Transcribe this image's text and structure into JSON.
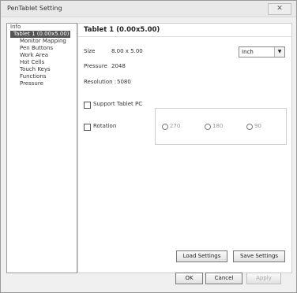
{
  "window": {
    "title": "PenTablet Setting",
    "close_label": "✕"
  },
  "sidebar": {
    "items": [
      {
        "label": "Info",
        "level": 0
      },
      {
        "label": "Tablet 1 (0.00x5.00)",
        "level": 0,
        "selected": true
      },
      {
        "label": "Monitor Mapping",
        "level": 1
      },
      {
        "label": "Pen Buttons",
        "level": 1
      },
      {
        "label": "Work Area",
        "level": 1
      },
      {
        "label": "Hot Cells",
        "level": 1
      },
      {
        "label": "Touch Keys",
        "level": 1
      },
      {
        "label": "Functions",
        "level": 1
      },
      {
        "label": "Pressure",
        "level": 1
      }
    ]
  },
  "main": {
    "title": "Tablet 1 (0.00x5.00)",
    "size": {
      "label": "Size",
      "value": "8.00 x 5.00"
    },
    "pressure": {
      "label": "Pressure",
      "value": "2048"
    },
    "resolution": {
      "label": "Resolution :",
      "value": "5080"
    },
    "units_select": {
      "value": "Inch"
    },
    "support_tablet_pc": {
      "label": "Support Tablet PC"
    },
    "rotation": {
      "label": "Rotation",
      "options": [
        "270",
        "180",
        "90"
      ]
    },
    "load_settings": "Load Settings",
    "save_settings": "Save Settings"
  },
  "footer": {
    "ok": "OK",
    "cancel": "Cancel",
    "apply": "Apply"
  }
}
